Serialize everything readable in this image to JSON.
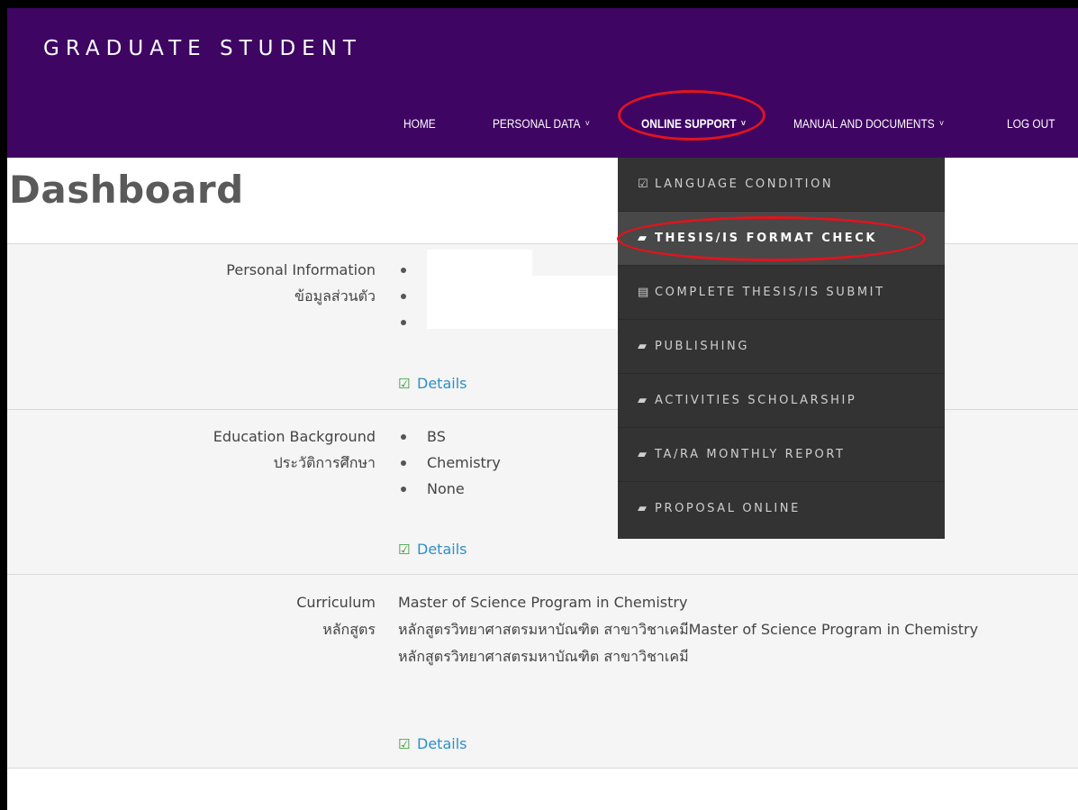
{
  "header": {
    "brand": "GRADUATE STUDENT",
    "nav": [
      {
        "label": "HOME",
        "has_dropdown": false
      },
      {
        "label": "PERSONAL DATA",
        "has_dropdown": true
      },
      {
        "label": "ONLINE SUPPORT",
        "has_dropdown": true
      },
      {
        "label": "MANUAL AND DOCUMENTS",
        "has_dropdown": true
      },
      {
        "label": "LOG OUT",
        "has_dropdown": false
      }
    ],
    "chevron": "˅"
  },
  "dropdown": {
    "items": [
      {
        "icon": "check-square-icon",
        "glyph": "☑",
        "label": "LANGUAGE CONDITION"
      },
      {
        "icon": "book-icon",
        "glyph": "▰",
        "label": "THESIS/IS FORMAT CHECK"
      },
      {
        "icon": "list-icon",
        "glyph": "▤",
        "label": "COMPLETE THESIS/IS SUBMIT"
      },
      {
        "icon": "book-icon",
        "glyph": "▰",
        "label": "PUBLISHING"
      },
      {
        "icon": "book-icon",
        "glyph": "▰",
        "label": "ACTIVITIES SCHOLARSHIP"
      },
      {
        "icon": "book-icon",
        "glyph": "▰",
        "label": "TA/RA MONTHLY REPORT"
      },
      {
        "icon": "book-icon",
        "glyph": "▰",
        "label": "PROPOSAL ONLINE"
      }
    ]
  },
  "page": {
    "title": "Dashboard"
  },
  "sections": {
    "personal": {
      "label_en": "Personal Information",
      "label_th": "ข้อมูลส่วนตัว",
      "details": "Details"
    },
    "education": {
      "label_en": "Education Background",
      "label_th": "ประวัติการศึกษา",
      "items": [
        "BS",
        "Chemistry",
        "None"
      ],
      "details": "Details"
    },
    "curriculum": {
      "label_en": "Curriculum",
      "label_th": "หลักสูตร",
      "line1": "Master of Science Program in Chemistry",
      "line2": "หลักสูตรวิทยาศาสตรมหาบัณฑิต สาขาวิชาเคมีMaster of Science Program in Chemistry",
      "line3": "หลักสูตรวิทยาศาสตรมหาบัณฑิต สาขาวิชาเคมี",
      "details": "Details"
    }
  },
  "colors": {
    "header_bg": "#3f0563",
    "dropdown_bg": "#333333",
    "link": "#2f8fc6",
    "highlight_circle": "#e0141e"
  }
}
